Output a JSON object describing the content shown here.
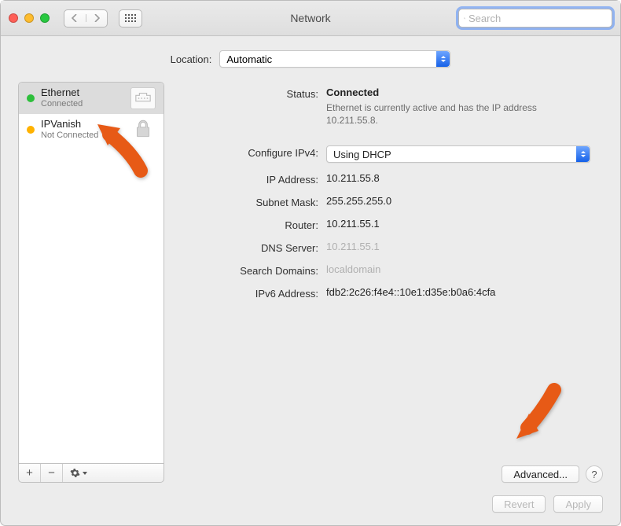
{
  "window": {
    "title": "Network"
  },
  "search": {
    "placeholder": "Search"
  },
  "location": {
    "label": "Location:",
    "selected": "Automatic"
  },
  "sidebar": {
    "items": [
      {
        "name": "Ethernet",
        "sub": "Connected",
        "dot": "#2dbf3b",
        "icon": "ethernet-icon"
      },
      {
        "name": "IPVanish",
        "sub": "Not Connected",
        "dot": "#ffb200",
        "icon": "lock-icon"
      }
    ],
    "buttons": {
      "add": "+",
      "remove": "−"
    }
  },
  "detail": {
    "status_label": "Status:",
    "status_value": "Connected",
    "status_desc": "Ethernet is currently active and has the IP address 10.211.55.8.",
    "configure_label": "Configure IPv4:",
    "configure_value": "Using DHCP",
    "ip_label": "IP Address:",
    "ip_value": "10.211.55.8",
    "subnet_label": "Subnet Mask:",
    "subnet_value": "255.255.255.0",
    "router_label": "Router:",
    "router_value": "10.211.55.1",
    "dns_label": "DNS Server:",
    "dns_value": "10.211.55.1",
    "search_label": "Search Domains:",
    "search_value": "localdomain",
    "ipv6_label": "IPv6 Address:",
    "ipv6_value": "fdb2:2c26:f4e4::10e1:d35e:b0a6:4cfa",
    "advanced_label": "Advanced...",
    "help_label": "?"
  },
  "footer": {
    "revert": "Revert",
    "apply": "Apply"
  }
}
